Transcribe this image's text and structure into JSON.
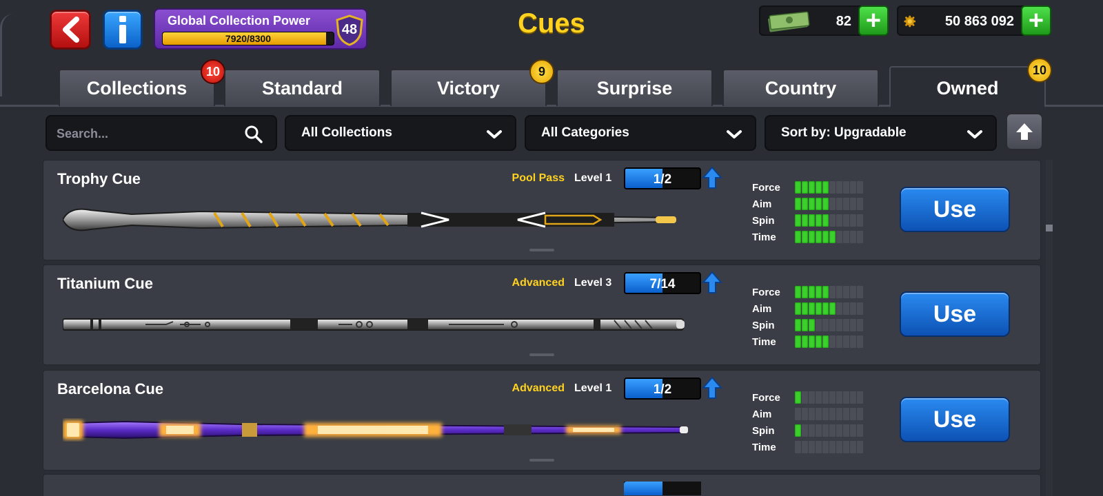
{
  "header": {
    "title": "Cues",
    "back_icon": "back-arrow-icon",
    "info_icon": "info-icon",
    "global_power": {
      "label": "Global Collection Power",
      "progress_text": "7920/8300",
      "current": 7920,
      "max": 8300,
      "level": "48"
    },
    "cash": {
      "value": "82",
      "icon": "cash-icon"
    },
    "coins": {
      "value": "50 863 092",
      "icon": "coin-icon"
    }
  },
  "tabs": [
    {
      "label": "Collections",
      "badge": "10",
      "badge_color": "red",
      "active": false
    },
    {
      "label": "Standard",
      "badge": "",
      "active": false
    },
    {
      "label": "Victory",
      "badge": "9",
      "badge_color": "yellow",
      "active": false
    },
    {
      "label": "Surprise",
      "badge": "",
      "active": false
    },
    {
      "label": "Country",
      "badge": "",
      "active": false
    },
    {
      "label": "Owned",
      "badge": "10",
      "badge_color": "yellow",
      "active": true
    }
  ],
  "filters": {
    "search_placeholder": "Search...",
    "collections": "All Collections",
    "categories": "All Categories",
    "sort": "Sort by: Upgradable"
  },
  "cues": [
    {
      "name": "Trophy Cue",
      "tier": "Pool Pass",
      "level": "Level 1",
      "progress_text": "1/2",
      "progress": 0.5,
      "stats": {
        "Force": 5,
        "Aim": 5,
        "Spin": 5,
        "Time": 6
      },
      "button": "Use"
    },
    {
      "name": "Titanium Cue",
      "tier": "Advanced",
      "level": "Level 3",
      "progress_text": "7/14",
      "progress": 0.5,
      "stats": {
        "Force": 5,
        "Aim": 6,
        "Spin": 3,
        "Time": 5
      },
      "button": "Use"
    },
    {
      "name": "Barcelona Cue",
      "tier": "Advanced",
      "level": "Level 1",
      "progress_text": "1/2",
      "progress": 0.5,
      "stats": {
        "Force": 1,
        "Aim": 0,
        "Spin": 1,
        "Time": 0
      },
      "button": "Use"
    }
  ],
  "stat_labels": [
    "Force",
    "Aim",
    "Spin",
    "Time"
  ],
  "stat_max": 10,
  "colors": {
    "title": "#ffd21f",
    "tier": "#ffd21f",
    "stat_on": "#3ad22a",
    "use_button": "#1a6ed8"
  }
}
